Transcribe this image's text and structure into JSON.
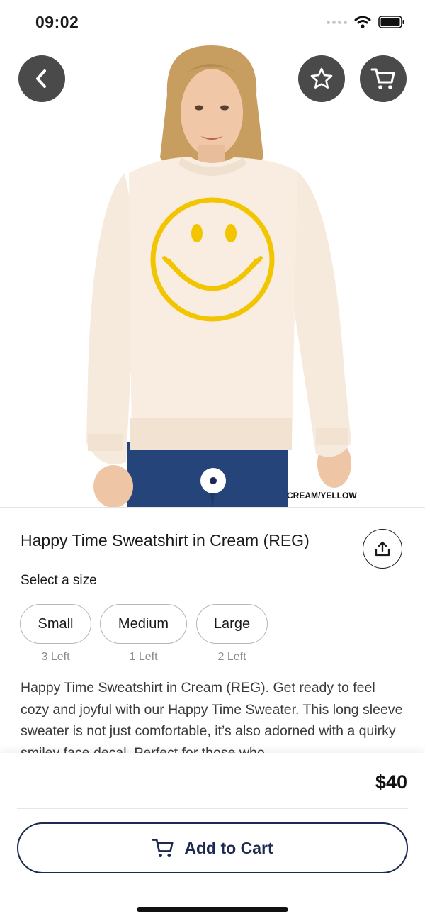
{
  "status_bar": {
    "time": "09:02"
  },
  "product_image": {
    "color_label": "CREAM/YELLOW"
  },
  "product": {
    "title": "Happy Time Sweatshirt in Cream (REG)",
    "size_heading": "Select a size",
    "sizes": [
      {
        "label": "Small",
        "stock": "3 Left"
      },
      {
        "label": "Medium",
        "stock": "1 Left"
      },
      {
        "label": "Large",
        "stock": "2 Left"
      }
    ],
    "description": "Happy Time Sweatshirt in Cream (REG). Get ready to feel cozy and joyful with our Happy Time Sweater. This long sleeve sweater is not just comfortable, it’s also adorned with a quirky smiley face decal. Perfect for those who"
  },
  "cart_bar": {
    "price": "$40",
    "add_label": "Add to Cart"
  },
  "icons": {
    "back": "chevron-left-icon",
    "favorite": "star-icon",
    "cart": "cart-icon",
    "share": "share-icon"
  },
  "colors": {
    "accent": "#1c2a52",
    "icon_button_bg": "#4a4a4a",
    "smiley": "#f2c500"
  }
}
